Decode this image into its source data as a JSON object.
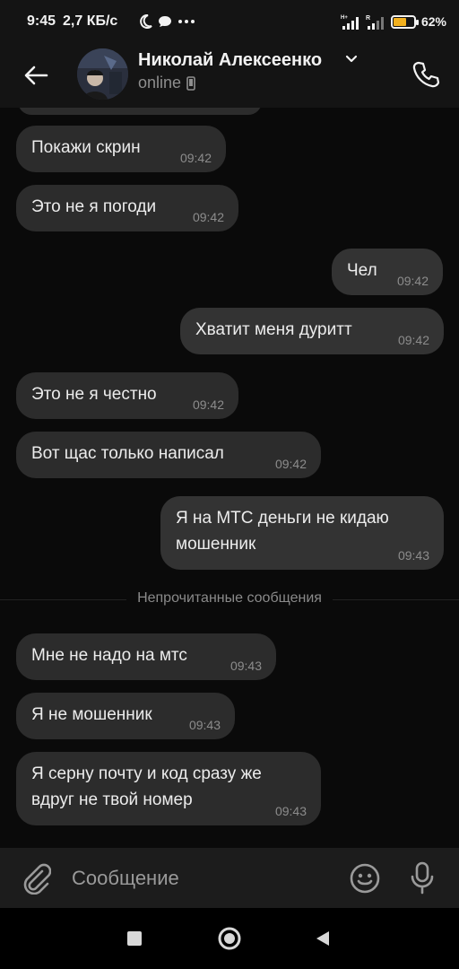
{
  "status_bar": {
    "time": "9:45",
    "network_speed": "2,7 КБ/с",
    "battery_percent": 62,
    "battery_label": "62%",
    "battery_color": "#f2b01e",
    "icons": [
      "moon-icon",
      "chat-bubble-icon",
      "more-dots-icon",
      "signal-h-plus-icon",
      "signal-r-icon",
      "battery-icon"
    ]
  },
  "header": {
    "contact_name": "Николай Алексеенко",
    "status": "online",
    "icons": [
      "back-arrow-icon",
      "chevron-down-icon",
      "phone-device-icon",
      "phone-call-icon"
    ]
  },
  "messages": [
    {
      "direction": "in",
      "text": "Покажи скрин",
      "time": "09:42"
    },
    {
      "direction": "in",
      "text": "Это не я погоди",
      "time": "09:42"
    },
    {
      "direction": "out",
      "text": "Чел",
      "time": "09:42"
    },
    {
      "direction": "out",
      "text": "Хватит меня дуритт",
      "time": "09:42"
    },
    {
      "direction": "in",
      "text": "Это не я честно",
      "time": "09:42"
    },
    {
      "direction": "in",
      "text": "Вот щас только написал",
      "time": "09:42"
    },
    {
      "direction": "out",
      "text_lines": [
        "Я на МТС деньги не кидаю",
        "мошенник"
      ],
      "time": "09:43"
    },
    {
      "direction": "in",
      "text": "Мне не надо на мтс",
      "time": "09:43"
    },
    {
      "direction": "in",
      "text": "Я не мошенник",
      "time": "09:43"
    },
    {
      "direction": "in",
      "text_lines": [
        "Я серну почту и код сразу же",
        "вдруг не твой номер"
      ],
      "time": "09:43"
    }
  ],
  "unread_divider": "Непрочитанные сообщения",
  "composer": {
    "placeholder": "Сообщение",
    "icons": [
      "paperclip-icon",
      "emoji-icon",
      "microphone-icon"
    ]
  },
  "nav_bar": {
    "icons": [
      "recents-square-icon",
      "home-circle-icon",
      "back-triangle-icon"
    ]
  }
}
